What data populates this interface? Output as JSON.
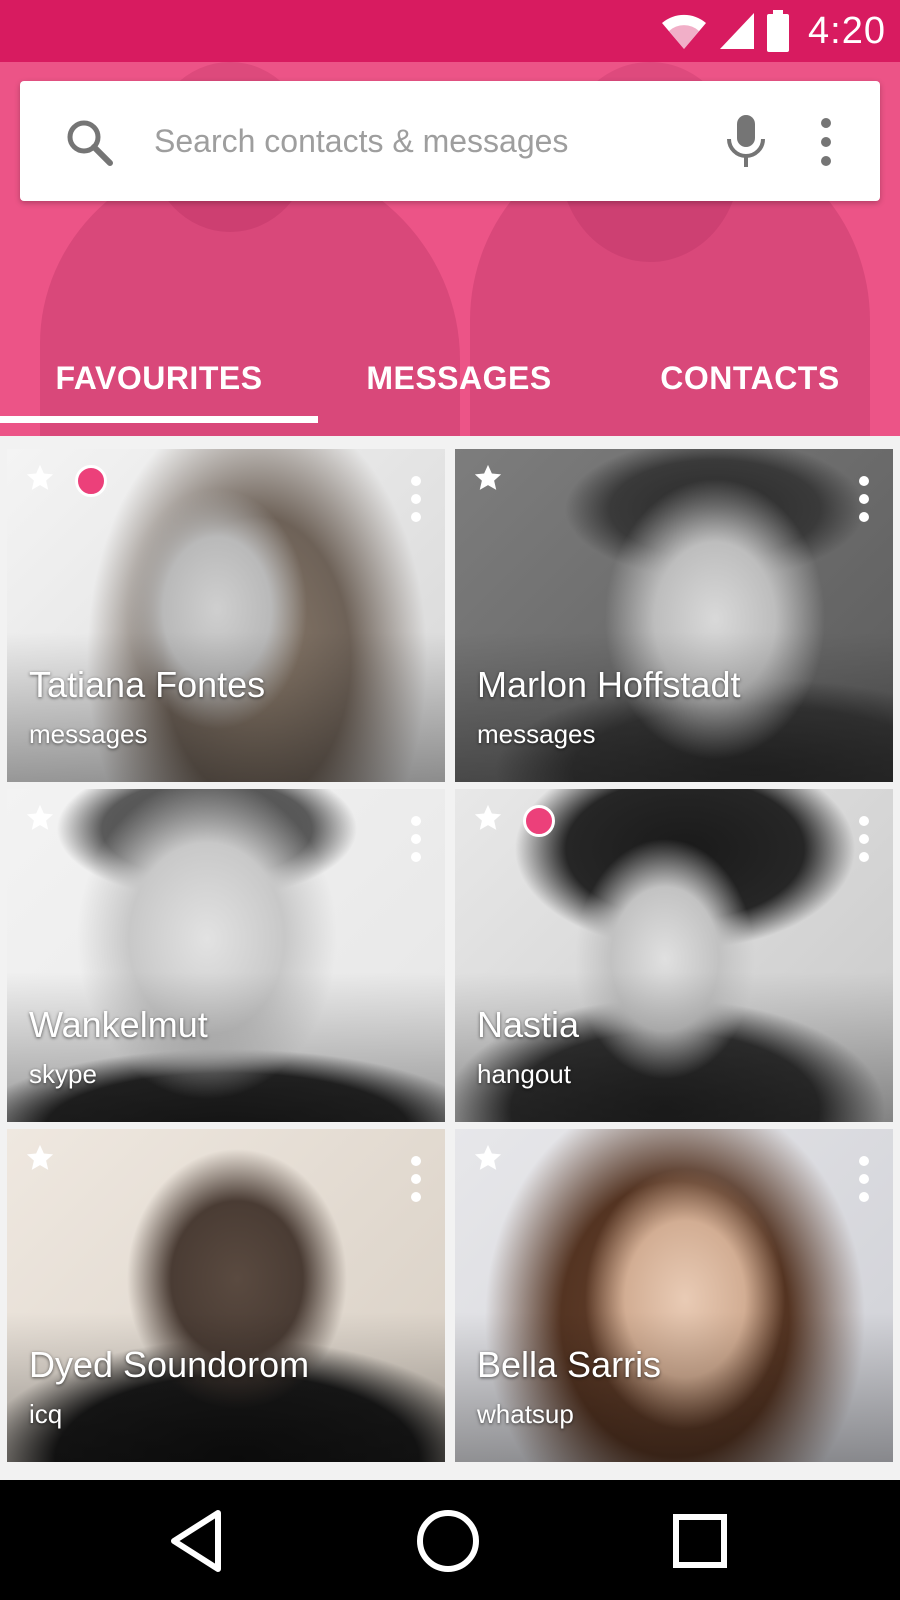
{
  "status_bar": {
    "time": "4:20",
    "icons": [
      "wifi-icon",
      "signal-icon",
      "battery-icon"
    ],
    "color": "#d81b60"
  },
  "header": {
    "background_color": "#ec5487",
    "search": {
      "placeholder": "Search contacts & messages",
      "icons": [
        "search-icon",
        "mic-icon",
        "more-vert-icon"
      ]
    },
    "tabs": [
      {
        "label": "FAVOURITES",
        "selected": true
      },
      {
        "label": "MESSAGES",
        "selected": false
      },
      {
        "label": "CONTACTS",
        "selected": false
      }
    ]
  },
  "favourites": [
    {
      "name": "Tatiana Fontes",
      "service": "messages",
      "starred": true,
      "online_indicator": true
    },
    {
      "name": "Marlon Hoffstadt",
      "service": "messages",
      "starred": true,
      "online_indicator": false
    },
    {
      "name": "Wankelmut",
      "service": "skype",
      "starred": true,
      "online_indicator": false
    },
    {
      "name": "Nastia",
      "service": "hangout",
      "starred": true,
      "online_indicator": true
    },
    {
      "name": "Dyed Soundorom",
      "service": "icq",
      "starred": true,
      "online_indicator": false
    },
    {
      "name": "Bella Sarris",
      "service": "whatsup",
      "starred": true,
      "online_indicator": false
    }
  ],
  "accent_color": "#ec407a",
  "nav_bar": {
    "buttons": [
      "back-icon",
      "home-icon",
      "recent-apps-icon"
    ]
  }
}
